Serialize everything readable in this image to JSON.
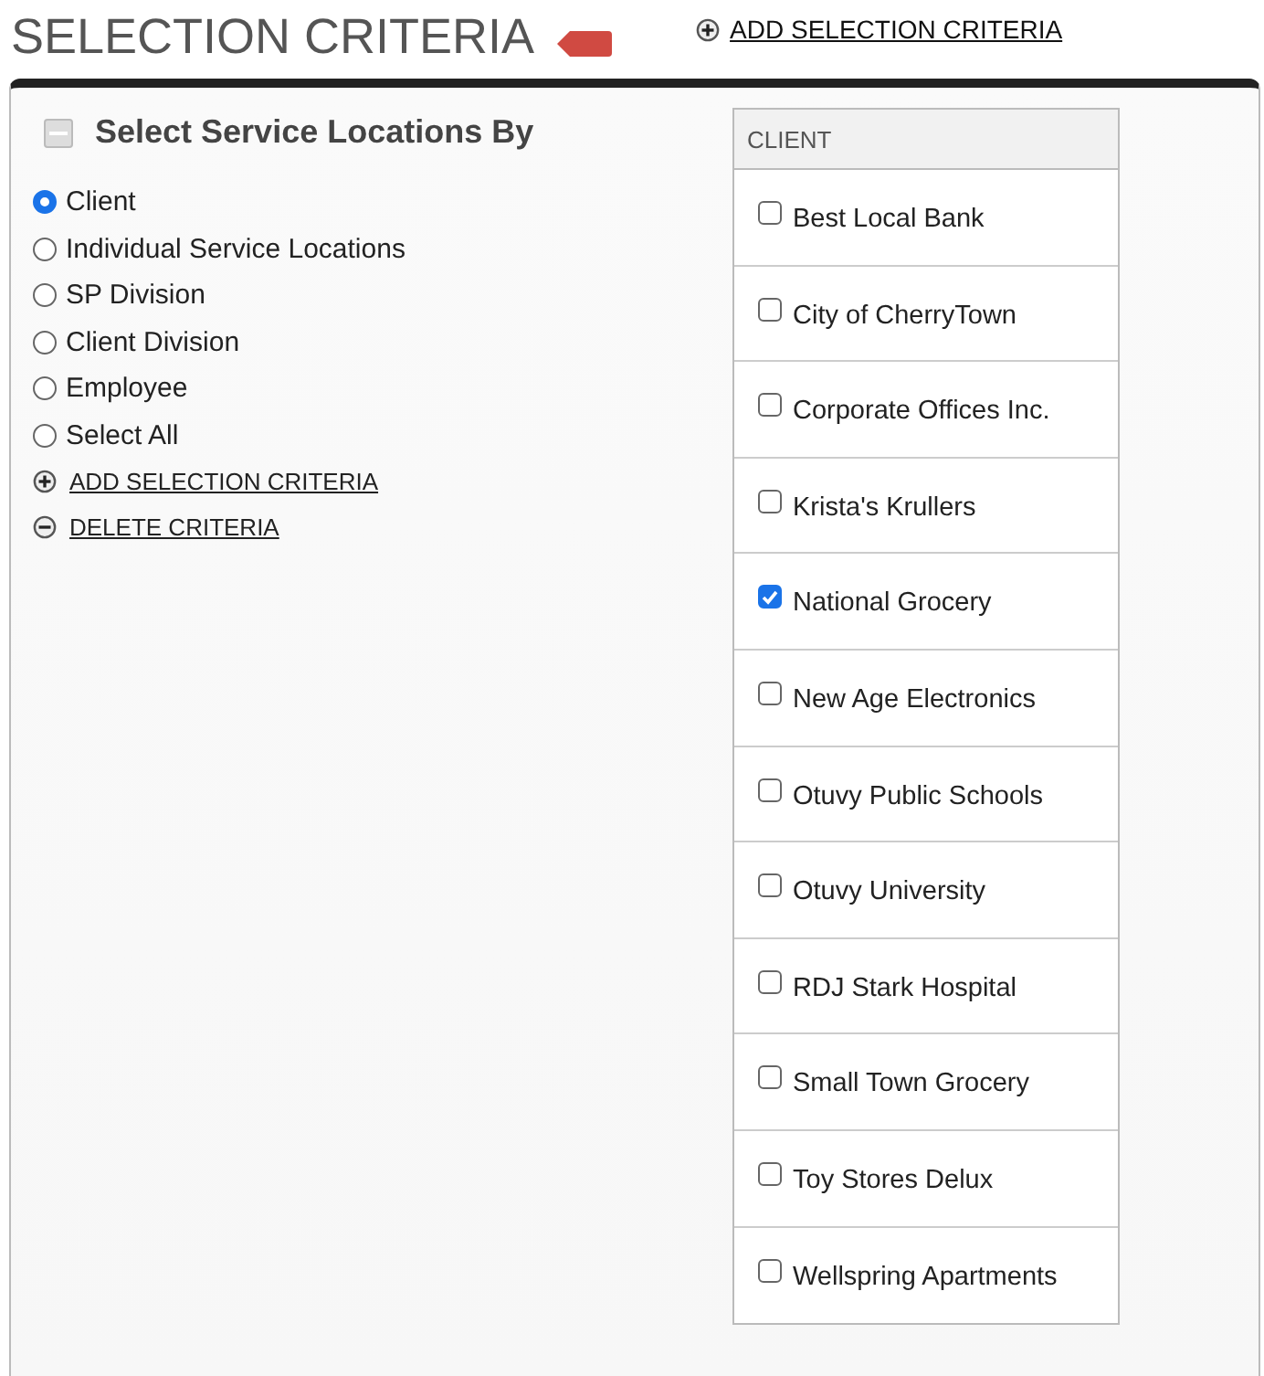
{
  "title": "SELECTION CRITERIA",
  "header_link": "ADD SELECTION CRITERIA",
  "section": {
    "title": "Select Service Locations By",
    "expanded": true
  },
  "options": [
    {
      "label": "Client",
      "selected": true
    },
    {
      "label": "Individual Service Locations",
      "selected": false
    },
    {
      "label": "SP Division",
      "selected": false
    },
    {
      "label": "Client Division",
      "selected": false
    },
    {
      "label": "Employee",
      "selected": false
    },
    {
      "label": "Select All",
      "selected": false
    }
  ],
  "actions": [
    {
      "kind": "add",
      "label": "ADD SELECTION CRITERIA"
    },
    {
      "kind": "delete",
      "label": "DELETE CRITERIA"
    }
  ],
  "table": {
    "column": "CLIENT",
    "rows": [
      {
        "label": "Best Local Bank",
        "checked": false
      },
      {
        "label": "City of CherryTown",
        "checked": false
      },
      {
        "label": "Corporate Offices Inc.",
        "checked": false
      },
      {
        "label": "Krista's Krullers",
        "checked": false
      },
      {
        "label": "National Grocery",
        "checked": true
      },
      {
        "label": "New Age Electronics",
        "checked": false
      },
      {
        "label": "Otuvy Public Schools",
        "checked": false
      },
      {
        "label": "Otuvy University",
        "checked": false
      },
      {
        "label": "RDJ Stark Hospital",
        "checked": false
      },
      {
        "label": "Small Town Grocery",
        "checked": false
      },
      {
        "label": "Toy Stores Delux",
        "checked": false
      },
      {
        "label": "Wellspring Apartments",
        "checked": false
      }
    ]
  }
}
